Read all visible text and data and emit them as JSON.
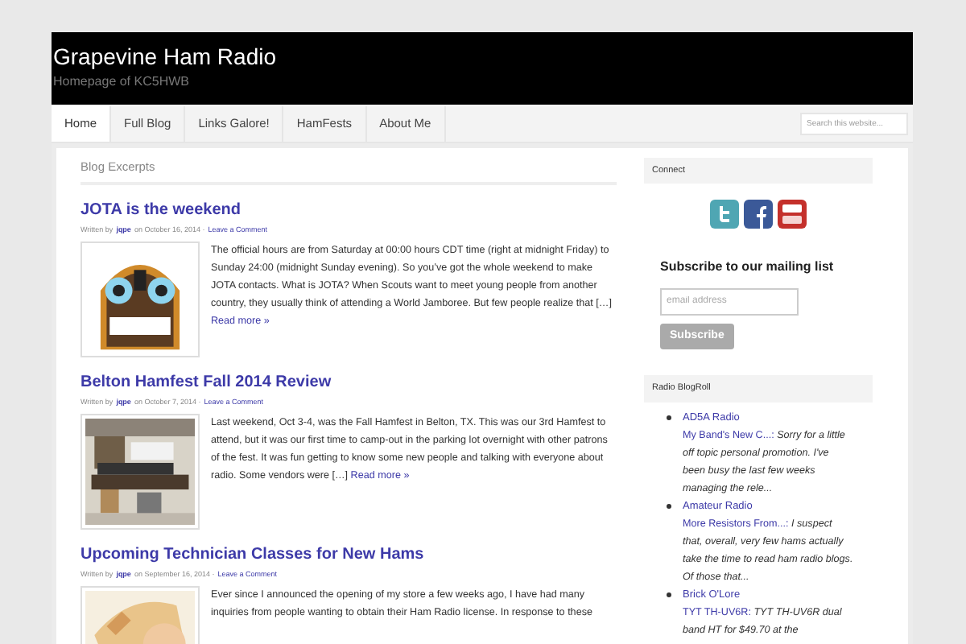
{
  "header": {
    "title": "Grapevine Ham Radio",
    "tagline": "Homepage of KC5HWB"
  },
  "nav": {
    "tabs": [
      {
        "label": "Home",
        "selected": true
      },
      {
        "label": "Full Blog",
        "selected": false
      },
      {
        "label": "Links Galore!",
        "selected": false
      },
      {
        "label": "HamFests",
        "selected": false
      },
      {
        "label": "About Me",
        "selected": false
      }
    ],
    "search": {
      "placeholder": "Search this website..."
    }
  },
  "main": {
    "heading": "Blog Excerpts",
    "posts": [
      {
        "title": "JOTA is the weekend",
        "byline_prefix": "Written by",
        "author": "jqpe",
        "date": "on October 16, 2014 ·",
        "comments": "Leave a Comment",
        "excerpt": "The official hours are from Saturday at 00:00 hours CDT time (right at midnight Friday) to Sunday 24:00 (midnight Sunday evening). So you’ve got the whole weekend to make JOTA contacts. What is JOTA? When Scouts want to meet young people from another country, they usually think of attending a World Jamboree. But few people realize that […]",
        "more": "Read more »"
      },
      {
        "title": "Belton Hamfest Fall 2014 Review",
        "byline_prefix": "Written by",
        "author": "jqpe",
        "date": "on October 7, 2014 ·",
        "comments": "Leave a Comment",
        "excerpt": "Last weekend, Oct 3-4, was the Fall Hamfest in Belton, TX. This was our 3rd Hamfest to attend, but it was our first time to camp-out in the parking lot overnight with other patrons of the fest. It was fun getting to know some new people and talking with everyone about radio. Some vendors were […]",
        "more": "Read more »"
      },
      {
        "title": "Upcoming Technician Classes for New Hams",
        "byline_prefix": "Written by",
        "author": "jqpe",
        "date": "on September 16, 2014 ·",
        "comments": "Leave a Comment",
        "excerpt": "Ever since I announced the opening of my store a few weeks ago, I have had many inquiries from people wanting to obtain their Ham Radio license.  In response to these"
      }
    ]
  },
  "sidebar": {
    "connect": {
      "title": "Connect"
    },
    "subscribe": {
      "title": "Subscribe to our mailing list",
      "placeholder": "email address",
      "button": "Subscribe"
    },
    "blogroll": {
      "title": "Radio BlogRoll",
      "items": [
        {
          "site": "AD5A Radio",
          "post": "My Band's New C...:",
          "snippet": "Sorry for a little off topic personal promotion. I've been busy the last few weeks managing the rele..."
        },
        {
          "site": "Amateur Radio",
          "post": "More Resistors From...:",
          "snippet": "I suspect that, overall, very few hams actually take the time to read ham radio blogs. Of those that..."
        },
        {
          "site": "Brick O'Lore",
          "post": "TYT TH-UV6R:",
          "snippet": "TYT TH-UV6R dual band HT for $49.70 at the"
        }
      ]
    }
  }
}
